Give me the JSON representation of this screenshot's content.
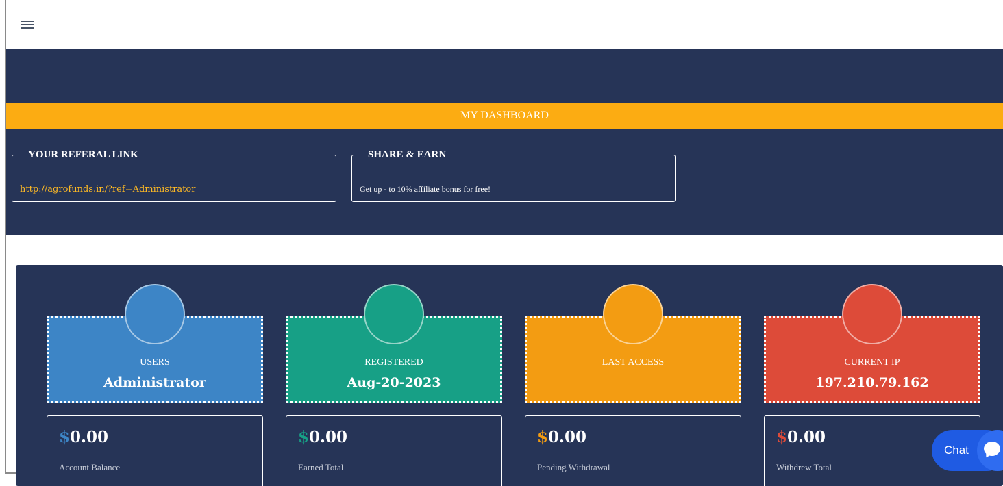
{
  "header": {
    "menu_icon": "hamburger-menu-icon"
  },
  "dashboard": {
    "title": "MY DASHBOARD"
  },
  "referral": {
    "legend": "YOUR REFERAL LINK",
    "link": "http://agrofunds.in/?ref=Administrator"
  },
  "share": {
    "legend": "SHARE & EARN",
    "text": "Get up - to 10% affiliate bonus for free!"
  },
  "stats": [
    {
      "label": "USERS",
      "value": "Administrator",
      "color": "#3d85c6"
    },
    {
      "label": "REGISTERED",
      "value": "Aug-20-2023",
      "color": "#17a086"
    },
    {
      "label": "LAST ACCESS",
      "value": "",
      "color": "#f39c12"
    },
    {
      "label": "CURRENT IP",
      "value": "197.210.79.162",
      "color": "#dd4b39"
    }
  ],
  "balances": [
    {
      "symbol": "$",
      "amount": "0.00",
      "label": "Account Balance",
      "symbol_color": "#3d85c6"
    },
    {
      "symbol": "$",
      "amount": "0.00",
      "label": "Earned Total",
      "symbol_color": "#17a086"
    },
    {
      "symbol": "$",
      "amount": "0.00",
      "label": "Pending Withdrawal",
      "symbol_color": "#f39c12"
    },
    {
      "symbol": "$",
      "amount": "0.00",
      "label": "Withdrew Total",
      "symbol_color": "#dd4b39"
    }
  ],
  "chat": {
    "label": "Chat",
    "icon": "chat-bubble-icon"
  }
}
